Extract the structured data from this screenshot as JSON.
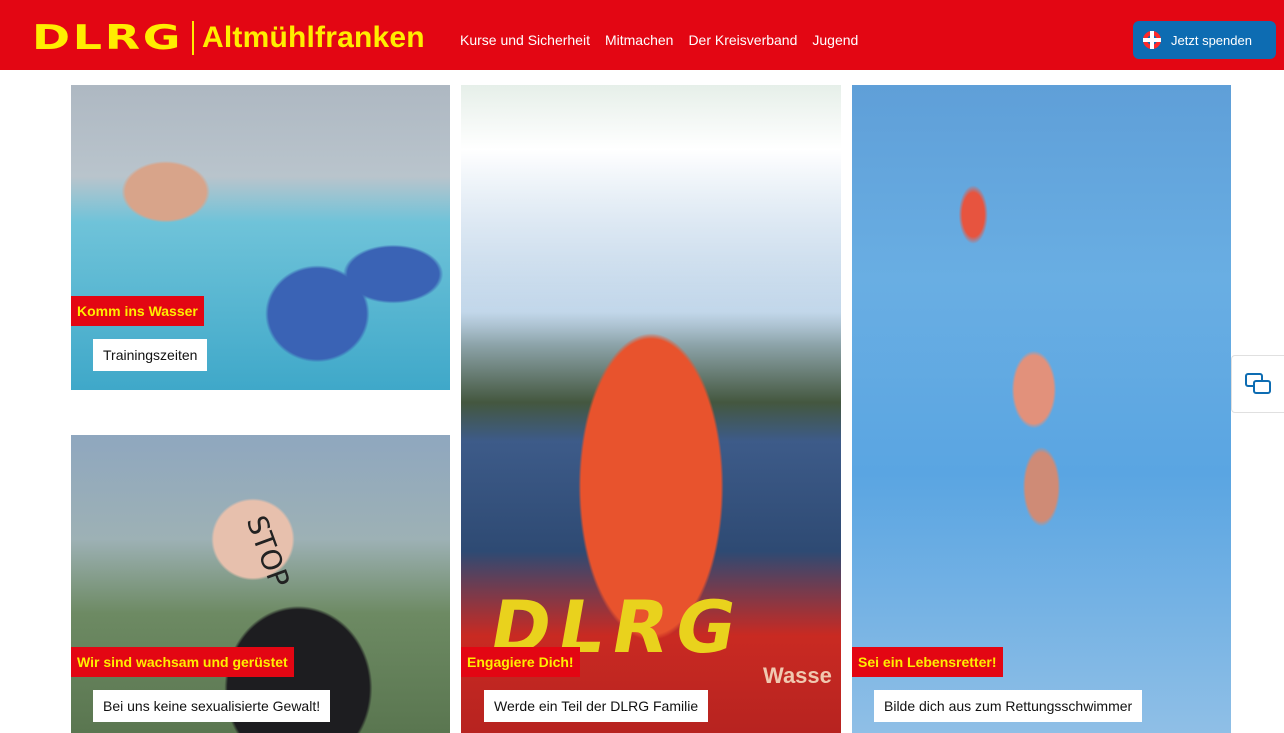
{
  "header": {
    "logo_brand": "DLRG",
    "logo_region": "Altmühlfranken",
    "nav": [
      "Kurse und Sicherheit",
      "Mitmachen",
      "Der Kreisverband",
      "Jugend"
    ],
    "donate_label": "Jetzt spenden",
    "brand_red": "#e30613",
    "brand_yellow": "#ffed00",
    "donate_blue": "#0d6cb2"
  },
  "tiles": [
    {
      "heading": "Komm ins Wasser",
      "link": "Trainingszeiten"
    },
    {
      "heading": "Wir sind wachsam und gerüstet",
      "link": "Bei uns keine sexualisierte Gewalt!",
      "image_text": "STOP"
    },
    {
      "heading": "Engagiere Dich!",
      "link": "Werde ein Teil der DLRG Familie",
      "image_text": "DLRG",
      "image_text_2": "Wasse"
    },
    {
      "heading": "Sei ein Lebensretter!",
      "link": "Bilde dich aus zum Rettungsschwimmer"
    }
  ],
  "icons": {
    "donate": "lifebuoy-icon",
    "chat": "chat-icon"
  }
}
